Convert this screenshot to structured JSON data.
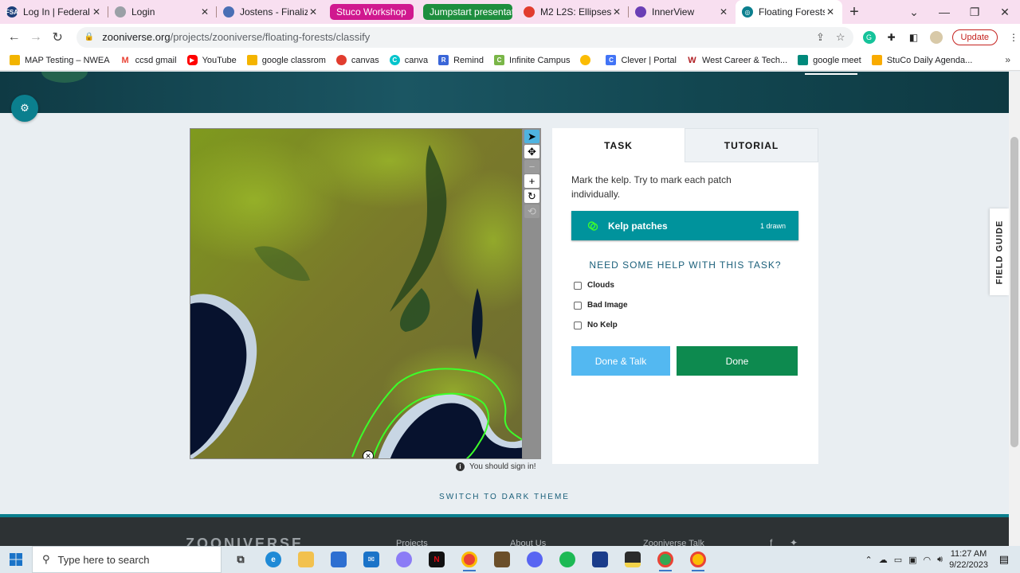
{
  "browser": {
    "tabs": [
      {
        "title": "Log In | Federal Stu",
        "icon": "fsa-icon",
        "color": "#1d3f7a"
      },
      {
        "title": "Login",
        "icon": "globe-icon",
        "color": "#9aa0a6"
      },
      {
        "title": "Jostens - Finalize C",
        "icon": "jostens-icon",
        "color": "#4a6fb5"
      }
    ],
    "group_tabs": [
      {
        "title": "Stuco Workshop",
        "color": "#d0188f"
      },
      {
        "title": "Jumpstart presentatio",
        "color": "#1e8e3e"
      }
    ],
    "tabs_after": [
      {
        "title": "M2 L2S: Ellipses",
        "icon": "canvas-icon",
        "color": "#e13c2e"
      },
      {
        "title": "InnerView",
        "icon": "innerview-icon",
        "color": "#6a3fb5"
      }
    ],
    "active_tab": {
      "title": "Floating Forests »",
      "icon": "zooniverse-icon",
      "color": "#0b7f8e"
    },
    "new_tab": "+",
    "url_host": "zooniverse.org",
    "url_path": "/projects/zooniverse/floating-forests/classify",
    "update_label": "Update",
    "bookmarks": [
      {
        "label": "MAP Testing – NWEA",
        "color": "#f2b400"
      },
      {
        "label": "ccsd gmail",
        "color": "#ea4335"
      },
      {
        "label": "YouTube",
        "color": "#ff0000"
      },
      {
        "label": "google classrom",
        "color": "#f4b400"
      },
      {
        "label": "canvas",
        "color": "#e13c2e"
      },
      {
        "label": "canva",
        "color": "#00c4cc"
      },
      {
        "label": "Remind",
        "color": "#3a66d8"
      },
      {
        "label": "Infinite Campus",
        "color": "#7ab648"
      },
      {
        "label": "",
        "color": "#fbbc04"
      },
      {
        "label": "Clever | Portal",
        "color": "#4274f6"
      },
      {
        "label": "West Career & Tech...",
        "color": "#b01e23"
      },
      {
        "label": "google meet",
        "color": "#00897b"
      },
      {
        "label": "StuCo Daily Agenda...",
        "color": "#f9ab00"
      }
    ],
    "bookmarks_more": "»"
  },
  "classifier": {
    "tools": [
      "pointer-icon",
      "move-icon",
      "zoom-out-icon",
      "zoom-in-icon",
      "rotate-icon",
      "reset-icon"
    ],
    "sign_in_note": "You should sign in!",
    "marked_patches": 1
  },
  "task_panel": {
    "tab_task": "TASK",
    "tab_tutorial": "TUTORIAL",
    "instruction": "Mark the kelp. Try to mark each patch individually.",
    "tool_label": "Kelp patches",
    "tool_count": "1 drawn",
    "help_label": "NEED SOME HELP WITH THIS TASK?",
    "checkboxes": [
      {
        "label": "Clouds",
        "checked": false
      },
      {
        "label": "Bad Image",
        "checked": false
      },
      {
        "label": "No Kelp",
        "checked": false
      }
    ],
    "done_talk_label": "Done & Talk",
    "done_label": "Done"
  },
  "page": {
    "field_guide": "FIELD GUIDE",
    "dark_theme": "SWITCH TO DARK THEME",
    "footer_logo": "ZOONIVERSE",
    "footer_links": [
      "Projects",
      "About Us",
      "Zooniverse Talk"
    ],
    "accent_color": "#0b7f8e"
  },
  "taskbar": {
    "search_placeholder": "Type here to search",
    "time": "11:27 AM",
    "date": "9/22/2023"
  }
}
